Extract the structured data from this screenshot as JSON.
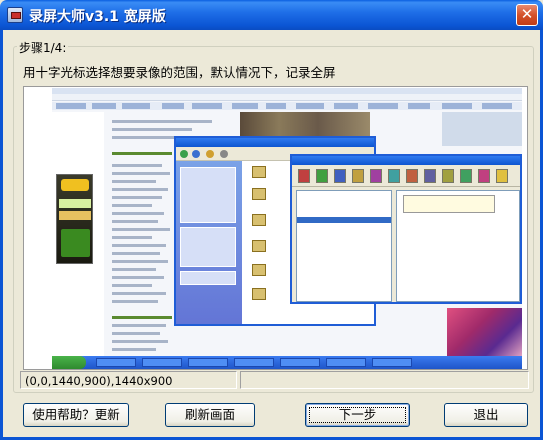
{
  "window": {
    "title": "录屏大师v3.1 宽屏版",
    "close_glyph": "✕"
  },
  "step": {
    "label": "步骤1/4:",
    "instruction": "用十字光标选择想要录像的范围，默认情况下，记录全屏"
  },
  "status": {
    "region": "(0,0,1440,900),1440x900",
    "secondary": ""
  },
  "buttons": {
    "help_update": "使用帮助？更新",
    "refresh": "刷新画面",
    "next": "下一步",
    "exit": "退出"
  },
  "preview": {
    "description_icon": "screen-preview-image"
  }
}
